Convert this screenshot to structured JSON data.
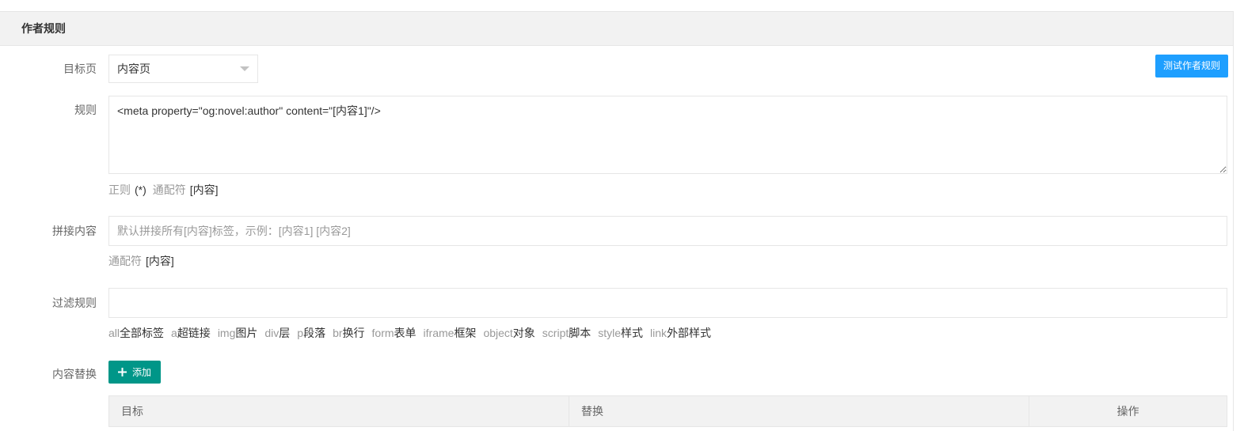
{
  "panel": {
    "title": "作者规则"
  },
  "target_page": {
    "label": "目标页",
    "value": "内容页",
    "arrow_icon": "triangle-down-icon"
  },
  "test_button": {
    "label": "测试作者规则",
    "color": "#1E9FFF"
  },
  "rule": {
    "label": "规则",
    "value": "<meta property=\"og:novel:author\" content=\"[内容1]\"/>",
    "hints": [
      {
        "name": "正则",
        "code": "(*)"
      },
      {
        "name": "通配符",
        "code": "[内容]"
      }
    ]
  },
  "join": {
    "label": "拼接内容",
    "placeholder": "默认拼接所有[内容]标签，示例：[内容1] [内容2]",
    "hints": [
      {
        "name": "通配符",
        "code": "[内容]"
      }
    ]
  },
  "filter": {
    "label": "过滤规则",
    "tags": [
      {
        "code": "all",
        "name": "全部标签"
      },
      {
        "code": "a",
        "name": "超链接"
      },
      {
        "code": "img",
        "name": "图片"
      },
      {
        "code": "div",
        "name": "层"
      },
      {
        "code": "p",
        "name": "段落"
      },
      {
        "code": "br",
        "name": "换行"
      },
      {
        "code": "form",
        "name": "表单"
      },
      {
        "code": "iframe",
        "name": "框架"
      },
      {
        "code": "object",
        "name": "对象"
      },
      {
        "code": "script",
        "name": "脚本"
      },
      {
        "code": "style",
        "name": "样式"
      },
      {
        "code": "link",
        "name": "外部样式"
      }
    ]
  },
  "replace": {
    "label": "内容替换",
    "add_button": {
      "icon": "plus-icon",
      "label": "添加",
      "color": "#009688"
    },
    "table": {
      "columns": [
        "目标",
        "替换",
        "操作"
      ]
    }
  }
}
